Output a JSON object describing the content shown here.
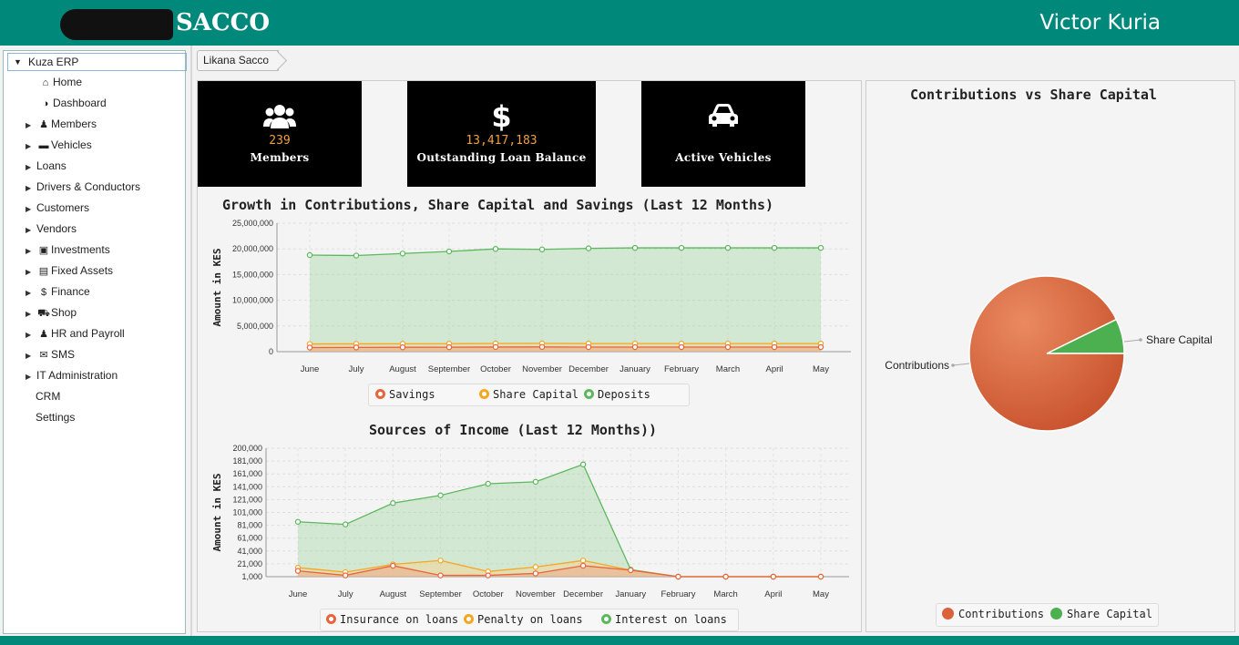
{
  "header": {
    "logo_text": "SACCO",
    "user_name": "Victor Kuria"
  },
  "sidebar": {
    "root_label": "Kuza ERP",
    "items": [
      {
        "label": "Home",
        "icon": "home-icon",
        "glyph": "⌂",
        "expandable": false
      },
      {
        "label": "Dashboard",
        "icon": "dashboard-icon",
        "glyph": "◑",
        "expandable": false
      },
      {
        "label": "Members",
        "icon": "user-icon",
        "glyph": "♟",
        "expandable": true
      },
      {
        "label": "Vehicles",
        "icon": "car-icon",
        "glyph": "▬",
        "expandable": true
      },
      {
        "label": "Loans",
        "icon": "",
        "glyph": "",
        "expandable": true
      },
      {
        "label": "Drivers & Conductors",
        "icon": "",
        "glyph": "",
        "expandable": true
      },
      {
        "label": "Customers",
        "icon": "",
        "glyph": "",
        "expandable": true
      },
      {
        "label": "Vendors",
        "icon": "",
        "glyph": "",
        "expandable": true
      },
      {
        "label": "Investments",
        "icon": "money-icon",
        "glyph": "▣",
        "expandable": true
      },
      {
        "label": "Fixed Assets",
        "icon": "building-icon",
        "glyph": "▤",
        "expandable": true
      },
      {
        "label": "Finance",
        "icon": "dollar-icon",
        "glyph": "$",
        "expandable": true
      },
      {
        "label": "Shop",
        "icon": "cart-icon",
        "glyph": "⛟",
        "expandable": true
      },
      {
        "label": "HR and Payroll",
        "icon": "users-icon",
        "glyph": "♟",
        "expandable": true
      },
      {
        "label": "SMS",
        "icon": "envelope-icon",
        "glyph": "✉",
        "expandable": true
      },
      {
        "label": "IT Administration",
        "icon": "",
        "glyph": "",
        "expandable": true
      },
      {
        "label": "CRM",
        "icon": "",
        "glyph": "",
        "expandable": false
      },
      {
        "label": "Settings",
        "icon": "",
        "glyph": "",
        "expandable": false
      }
    ]
  },
  "breadcrumb": {
    "label": "Likana Sacco"
  },
  "tiles": [
    {
      "label": "Members",
      "value": "239",
      "icon": "users-icon",
      "glyph": "♟♟"
    },
    {
      "label": "Outstanding Loan Balance",
      "value": "13,417,183",
      "icon": "dollar-icon",
      "glyph": "$"
    },
    {
      "label": "Active Vehicles",
      "value": "",
      "icon": "car-icon",
      "glyph": "⛟"
    }
  ],
  "chart_data": [
    {
      "type": "area",
      "title": "Growth in Contributions, Share Capital and Savings (Last 12 Months)",
      "ylabel": "Amount in KES",
      "xlabel": "",
      "ylim": [
        0,
        25000000
      ],
      "yticks": [
        "25,000,000",
        "20,000,000",
        "15,000,000",
        "10,000,000",
        "5,000,000",
        "0"
      ],
      "categories": [
        "June",
        "July",
        "August",
        "September",
        "October",
        "November",
        "December",
        "January",
        "February",
        "March",
        "April",
        "May"
      ],
      "series": [
        {
          "name": "Savings",
          "color": "#e8643c",
          "values": [
            800000,
            820000,
            850000,
            870000,
            900000,
            920000,
            880000,
            880000,
            880000,
            880000,
            880000,
            880000
          ]
        },
        {
          "name": "Share Capital",
          "color": "#f5a623",
          "values": [
            1500000,
            1520000,
            1530000,
            1550000,
            1600000,
            1620000,
            1580000,
            1580000,
            1580000,
            1580000,
            1580000,
            1580000
          ]
        },
        {
          "name": "Deposits",
          "color": "#5cb85c",
          "values": [
            18800000,
            18700000,
            19100000,
            19500000,
            20000000,
            19900000,
            20100000,
            20200000,
            20200000,
            20200000,
            20200000,
            20200000
          ]
        }
      ],
      "legend": "bottom"
    },
    {
      "type": "area",
      "title": "Sources of Income (Last 12 Months))",
      "ylabel": "Amount in KES",
      "xlabel": "",
      "ylim": [
        1000,
        200000
      ],
      "yticks": [
        "200,000",
        "181,000",
        "161,000",
        "141,000",
        "121,000",
        "101,000",
        "81,000",
        "61,000",
        "41,000",
        "21,000",
        "1,000"
      ],
      "categories": [
        "June",
        "July",
        "August",
        "September",
        "October",
        "November",
        "December",
        "January",
        "February",
        "March",
        "April",
        "May"
      ],
      "series": [
        {
          "name": "Insurance on loans",
          "color": "#e8643c",
          "values": [
            10000,
            3000,
            18000,
            3000,
            3000,
            6000,
            18000,
            11000,
            1000,
            1000,
            1000,
            1000
          ]
        },
        {
          "name": "Penalty on loans",
          "color": "#f5a623",
          "values": [
            15000,
            8000,
            20000,
            26000,
            9000,
            16000,
            26000,
            11000,
            1000,
            1000,
            1000,
            1000
          ]
        },
        {
          "name": "Interest on loans",
          "color": "#5cb85c",
          "values": [
            86000,
            82000,
            115000,
            127000,
            145000,
            148000,
            175000,
            12000,
            1000,
            1000,
            1000,
            1000
          ]
        }
      ],
      "legend": "bottom"
    },
    {
      "type": "pie",
      "title": "Contributions vs Share Capital",
      "series": [
        {
          "name": "Contributions",
          "color": "#d9623b",
          "value": 20200000
        },
        {
          "name": "Share Capital",
          "color": "#4caf50",
          "value": 1580000
        }
      ],
      "legend": "bottom"
    }
  ],
  "footer": {
    "text": ""
  }
}
